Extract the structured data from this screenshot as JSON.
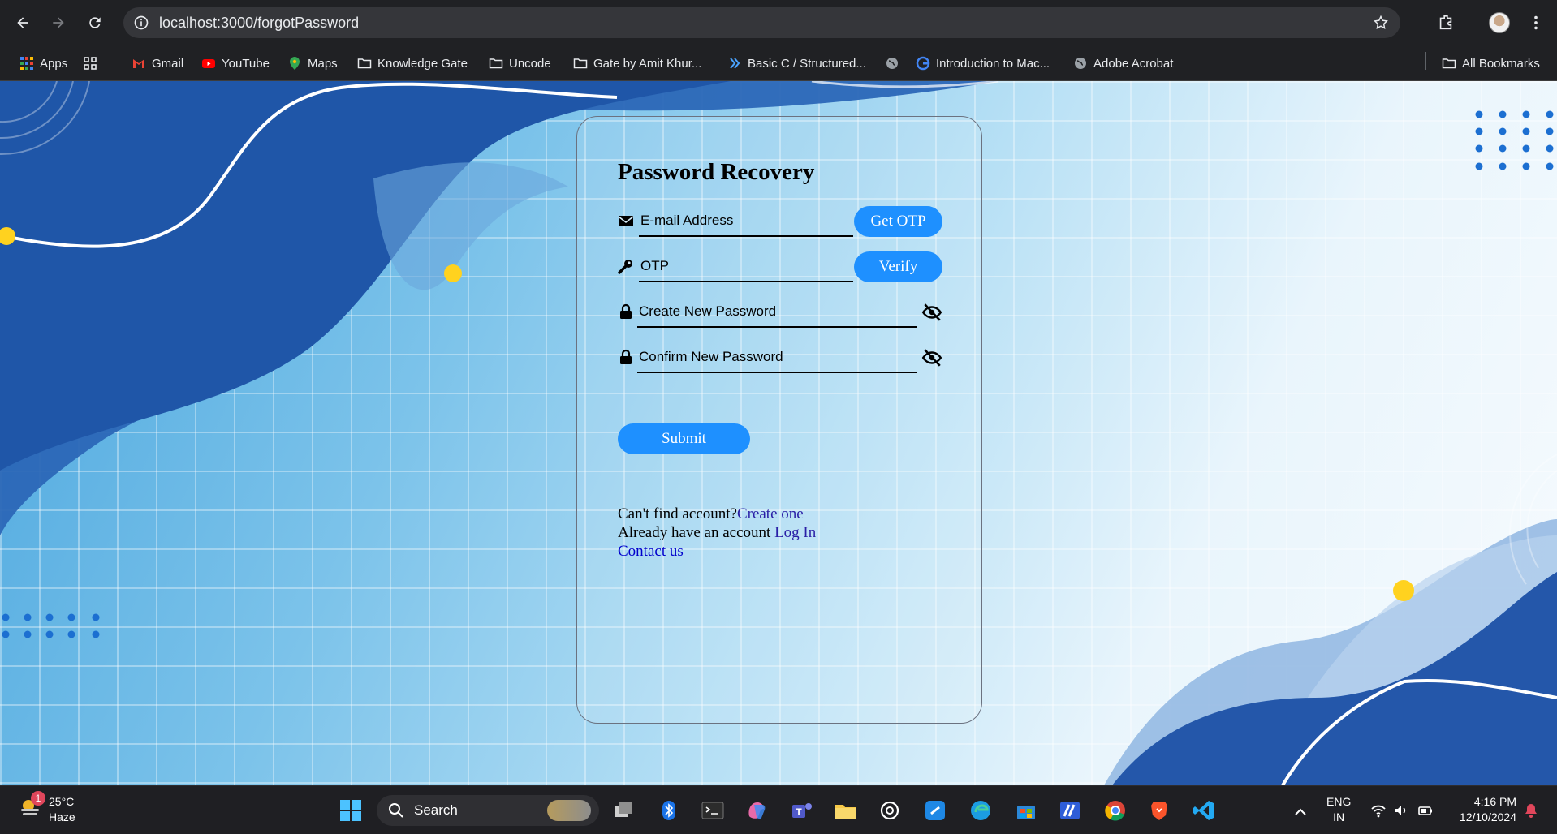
{
  "browser": {
    "url": "localhost:3000/forgotPassword",
    "bookmarks": [
      {
        "label": "Apps",
        "icon": "apps-grid-icon"
      },
      {
        "label": "Gmail",
        "icon": "gmail-icon"
      },
      {
        "label": "YouTube",
        "icon": "youtube-icon"
      },
      {
        "label": "Maps",
        "icon": "maps-icon"
      },
      {
        "label": "Knowledge Gate",
        "icon": "folder-icon"
      },
      {
        "label": "Uncode",
        "icon": "folder-icon"
      },
      {
        "label": "Gate by Amit Khur...",
        "icon": "folder-icon"
      },
      {
        "label": "Basic C / Structured...",
        "icon": "site-icon"
      },
      {
        "label": "Introduction to Mac...",
        "icon": "google-icon"
      },
      {
        "label": "Adobe Acrobat",
        "icon": "globe-icon"
      },
      {
        "label": "All Bookmarks",
        "icon": "folder-icon"
      }
    ]
  },
  "form": {
    "title": "Password Recovery",
    "email_placeholder": "E-mail Address",
    "get_otp": "Get OTP",
    "otp_placeholder": "OTP",
    "verify": "Verify",
    "new_password_placeholder": "Create New Password",
    "confirm_password_placeholder": "Confirm New Password",
    "submit": "Submit",
    "no_account_text": "Can't find account?",
    "create_link": "Create one",
    "have_account_text": "Already have an account",
    "login_link": "Log In",
    "contact_link": "Contact us"
  },
  "taskbar": {
    "weather_temp": "25°C",
    "weather_cond": "Haze",
    "weather_badge": "1",
    "search": "Search",
    "lang_top": "ENG",
    "lang_bottom": "IN",
    "time": "4:16 PM",
    "date": "12/10/2024"
  },
  "colors": {
    "accent": "#1e90ff",
    "link": "#2a1fa6",
    "chrome_bg": "#202124"
  }
}
